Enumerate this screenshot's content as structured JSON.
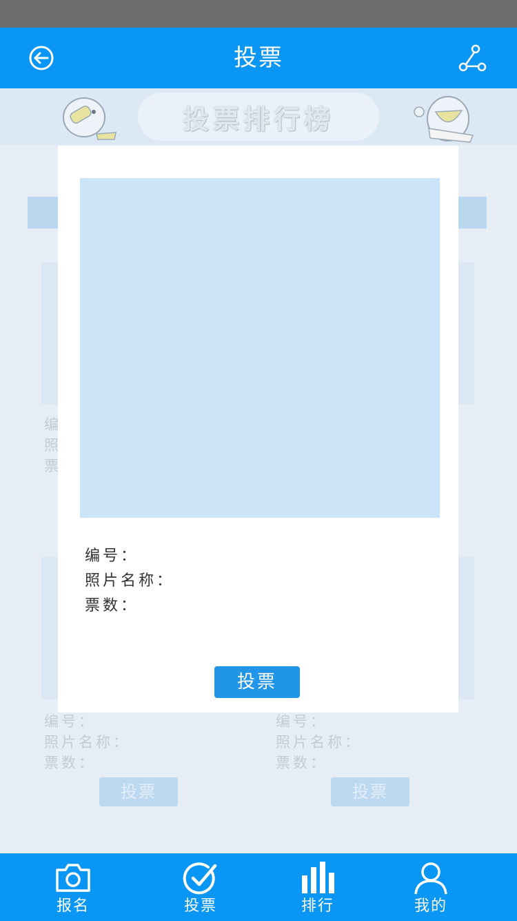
{
  "header": {
    "title": "投票"
  },
  "banner": {
    "text": "投票排行榜"
  },
  "modal": {
    "id_label": "编号：",
    "name_label": "照片名称：",
    "votes_label": "票数：",
    "vote_button": "投票"
  },
  "background_cards": [
    {
      "id_label": "编",
      "name_label": "照",
      "votes_label": "票"
    },
    {
      "id_label": "编号：",
      "name_label": "照片名称：",
      "votes_label": "票数：",
      "vote_button": "投票"
    },
    {
      "id_label": "编号：",
      "name_label": "照片名称：",
      "votes_label": "票数：",
      "vote_button": "投票"
    }
  ],
  "bottom_nav": [
    {
      "label": "报名",
      "icon": "camera-icon"
    },
    {
      "label": "投票",
      "icon": "check-circle-icon"
    },
    {
      "label": "排行",
      "icon": "bar-chart-icon"
    },
    {
      "label": "我的",
      "icon": "user-icon"
    }
  ],
  "colors": {
    "primary": "#0a96f4",
    "status_bar": "#6e6e6e",
    "vote_button": "#2196e8",
    "photo_placeholder": "#cce4f8"
  }
}
